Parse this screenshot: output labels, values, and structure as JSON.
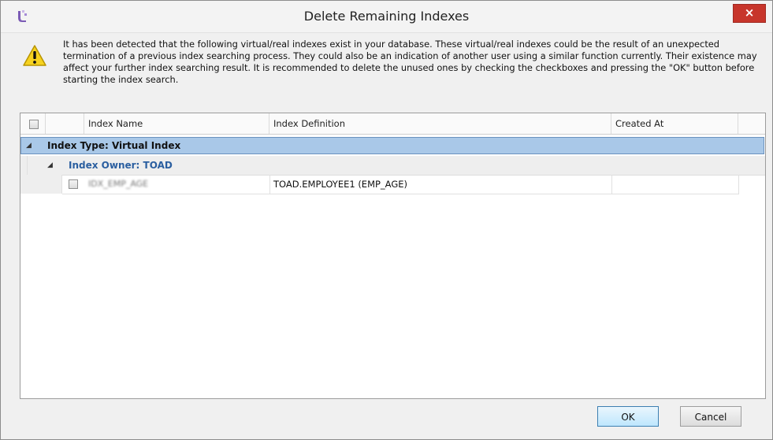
{
  "window": {
    "title": "Delete Remaining Indexes",
    "close_label": "×",
    "app_icon": "toad-app-icon",
    "accent_close": "#c7352b"
  },
  "message": {
    "icon": "warning-icon",
    "text": "It has been detected that the following virtual/real indexes exist in your database. These virtual/real indexes could be the result of an unexpected termination of a previous index searching process. They could also be an indication of another user using a similar function currently. Their existence may affect your further index searching result. It is recommended to delete the unused ones by checking the checkboxes and pressing the \"OK\" button before starting the index search."
  },
  "grid": {
    "columns": [
      "Index Name",
      "Index Definition",
      "Created At"
    ],
    "group_type": "Index Type: Virtual Index",
    "group_owner": "Index Owner: TOAD",
    "group_expander": "◢",
    "rows": [
      {
        "name": "IDX_EMP_AGE",
        "definition": "TOAD.EMPLOYEE1 (EMP_AGE)",
        "created_at": "",
        "checked": false
      }
    ],
    "selection_color": "#a9c8e8",
    "owner_color": "#2b5fa0"
  },
  "buttons": {
    "ok": "OK",
    "cancel": "Cancel"
  }
}
